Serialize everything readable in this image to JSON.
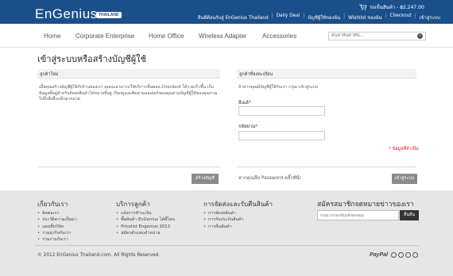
{
  "header": {
    "logo": "EnGenius",
    "logo_badge": "THAILAND",
    "cart_text": "รถเข็นสินค้า - ฿2,247.00",
    "links": [
      "ยินดีต้อนรับสู่ EnGenius Thailand",
      "Daily Deal",
      "บัญชีผู้ใช้ของฉัน",
      "Wishlist ของฉัน",
      "Checkout",
      "เข้าสู่ระบบ"
    ],
    "colors": {
      "brand": "#1b4f8c"
    }
  },
  "nav": {
    "items": [
      "Home",
      "Corporate Enterprise",
      "Home Office",
      "Wireless Adapter",
      "Accessories"
    ],
    "search_placeholder": "ค้นหาสินค้าที่นี่..."
  },
  "page": {
    "title": "เข้าสู่ระบบหรือสร้างบัญชีผู้ใช้"
  },
  "new_customer": {
    "heading": "ลูกค้าใหม่",
    "description": "เมื่อคุณสร้างบัญชีผู้ใช้กับร้านของเรา คุณจะสามารถใช้บริการขั้นตอน Checkout ได้รวดเร็วขึ้น เก็บข้อมูลที่อยู่สำหรับจัดส่งสินค้าได้หลายที่อยู่ เรียกดูและติดตามออเดอร์ของคุณผ่านบัญชีผู้ใช้ของคุณรวมไปถึงสิ่งอื่นๆอีกมากมาย",
    "button": "สร้างบัญชี"
  },
  "registered": {
    "heading": "ลูกค้าที่ลงทะเบียน",
    "description": "ถ้าหากคุณมีบัญชีผู้ใช้กับเรา กรุณาเข้าสู่ระบบ",
    "email_label": "อีเมล์",
    "password_label": "รหัสผ่าน",
    "required_marker": "*",
    "required_note": "* ข้อมูลที่จำเป็น",
    "forgot": "หากคุณลืม Password คลิ๊กที่นี่!",
    "button": "เข้าสู่ระบบ"
  },
  "footer": {
    "cols": [
      {
        "title": "เกี่ยวกับเรา",
        "items": [
          "ติดต่อเรา",
          "ประวัติความเป็นมา",
          "แผนที่บริษัท",
          "ร่วมธุรกิจกับเรา",
          "ร่วมงานกับเรา"
        ]
      },
      {
        "title": "บริการลูกค้า",
        "items": [
          "แจ้งการชำระเงิน",
          "ซื้อสินค้า EnGenius ได้ที่ไหน",
          "Pricelist Engenius 2013",
          "สมัครตัวแทนจำหน่าย"
        ]
      },
      {
        "title": "การจัดส่งและรับคืนสินค้า",
        "items": [
          "การจัดส่งสินค้า",
          "การรับประกันสินค้า",
          "การคืนสินค้า"
        ]
      }
    ],
    "newsletter": {
      "title": "สมัครสมาชิกจดหมายข่าวของเรา",
      "placeholder": "กรุณากรอกอีเมล์ของคุณ",
      "button": "ยืนยัน"
    },
    "copyright": "© 2012 EnGenius Thailand.com. All Rights Reserved.",
    "paypal": "PayPal"
  }
}
